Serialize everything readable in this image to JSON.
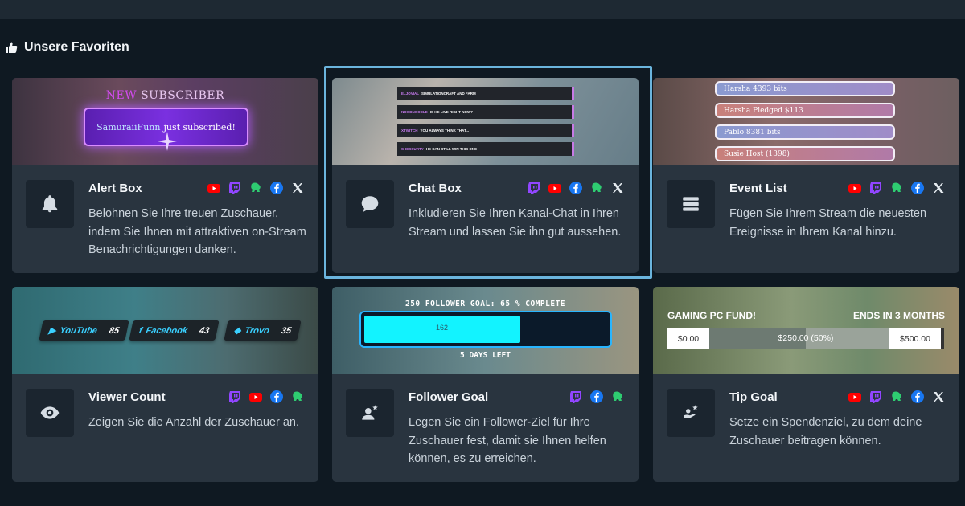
{
  "section_title": "Unsere Favoriten",
  "colors": {
    "selected_border": "#6ab4dd",
    "card_bg": "#29343f",
    "page_bg": "#0f1922"
  },
  "cards": [
    {
      "title": "Alert Box",
      "icon": "bell-icon",
      "description": "Belohnen Sie Ihre treuen Zuschauer, indem Sie Ihnen mit attraktiven on-Stream Benachrichtigungen danken.",
      "platforms": [
        "youtube",
        "twitch",
        "kick",
        "facebook",
        "x"
      ],
      "preview": {
        "heading_new": "NEW",
        "heading_rest": "SUBSCRIBER",
        "user": "SamuraiiFunn",
        "message": "just subscribed!"
      }
    },
    {
      "title": "Chat Box",
      "icon": "chat-bubble-icon",
      "description": "Inkludieren Sie Ihren Kanal-Chat in Ihren Stream und lassen Sie ihn gut aussehen.",
      "platforms": [
        "twitch",
        "youtube",
        "facebook",
        "kick",
        "x"
      ],
      "selected": true,
      "preview": {
        "messages": [
          {
            "user": "ELJOVIAL",
            "text": "SIMULATIONCRAFT AND FARM"
          },
          {
            "user": "NOODNOODLE",
            "text": "IS HE LIVE RIGHT NOW?"
          },
          {
            "user": "XTWITCH",
            "text": "YOU ALWAYS THINK THAT..."
          },
          {
            "user": "SHESCURTY",
            "text": "HE CAN STILL WIN THIS ONE"
          }
        ]
      }
    },
    {
      "title": "Event List",
      "icon": "list-icon",
      "description": "Fügen Sie Ihrem Stream die neuesten Ereignisse in Ihrem Kanal hinzu.",
      "platforms": [
        "youtube",
        "twitch",
        "kick",
        "facebook",
        "x"
      ],
      "preview": {
        "events": [
          "Harsha 4393 bits",
          "Harsha Pledged $113",
          "Pablo 8381 bits",
          "Susie Host (1398)"
        ]
      }
    },
    {
      "title": "Viewer Count",
      "icon": "eye-icon",
      "description": "Zeigen Sie die Anzahl der Zuschauer an.",
      "platforms": [
        "twitch",
        "youtube",
        "facebook",
        "kick"
      ],
      "preview": {
        "badges": [
          {
            "label": "YouTube",
            "count": "85"
          },
          {
            "label": "Facebook",
            "count": "43"
          },
          {
            "label": "Trovo",
            "count": "35"
          }
        ]
      }
    },
    {
      "title": "Follower Goal",
      "icon": "user-star-icon",
      "description": "Legen Sie ein Follower-Ziel für Ihre Zuschauer fest, damit sie Ihnen helfen können, es zu erreichen.",
      "platforms": [
        "twitch",
        "facebook",
        "kick"
      ],
      "preview": {
        "headline": "250 FOLLOWER GOAL: 65 % COMPLETE",
        "current": "162",
        "progress": 0.65,
        "footer": "5 DAYS LEFT"
      }
    },
    {
      "title": "Tip Goal",
      "icon": "tip-star-icon",
      "description": "Setze ein Spendenziel, zu dem deine Zuschauer beitragen können.",
      "platforms": [
        "youtube",
        "twitch",
        "kick",
        "facebook",
        "x"
      ],
      "preview": {
        "name": "GAMING PC FUND!",
        "ends": "ENDS IN 3 MONTHS",
        "min": "$0.00",
        "mid": "$250.00 (50%)",
        "max": "$500.00",
        "progress": 0.5
      }
    }
  ]
}
